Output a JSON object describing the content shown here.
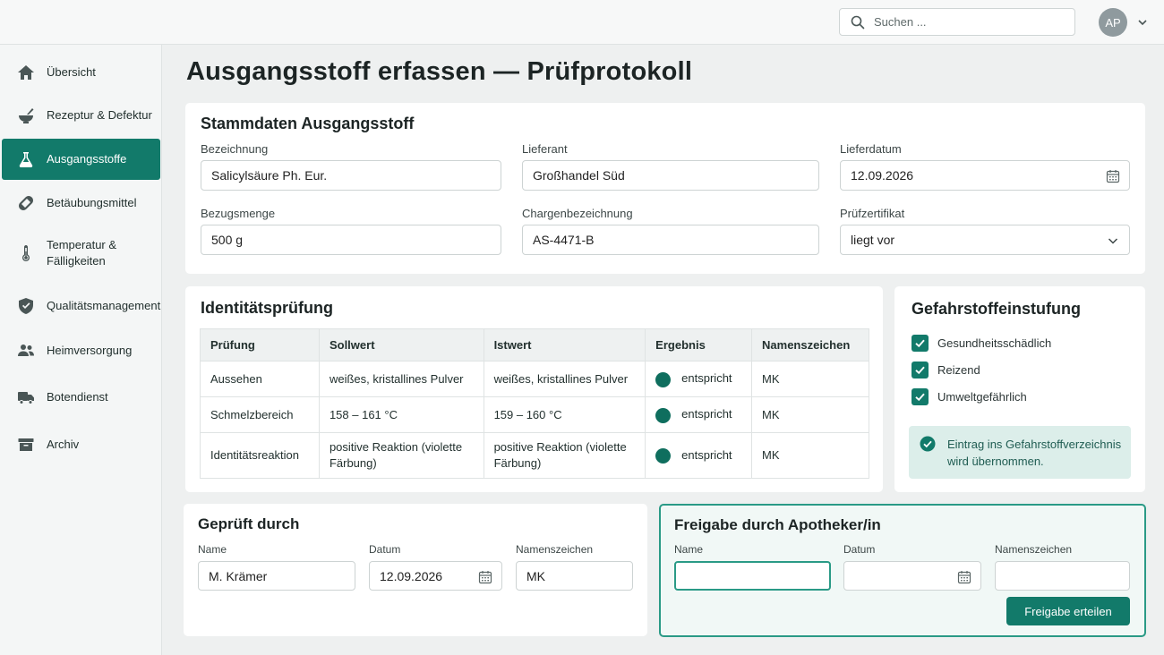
{
  "search": {
    "placeholder": "Suchen ..."
  },
  "user": {
    "initials": "AP"
  },
  "sidebar": {
    "items": [
      {
        "label": "Übersicht",
        "icon": "home-icon"
      },
      {
        "label": "Rezeptur & Defektur",
        "icon": "mortar-icon"
      },
      {
        "label": "Ausgangsstoffe",
        "icon": "flask-icon",
        "active": true
      },
      {
        "label": "Betäubungsmittel",
        "icon": "pill-icon"
      },
      {
        "label": "Temperatur & Fälligkeiten",
        "icon": "thermometer-icon"
      },
      {
        "label": "Qualitätsmanagement",
        "icon": "shield-check-icon"
      },
      {
        "label": "Heimversorgung",
        "icon": "people-icon"
      },
      {
        "label": "Botendienst",
        "icon": "truck-icon"
      },
      {
        "label": "Archiv",
        "icon": "archive-icon"
      }
    ]
  },
  "page": {
    "title": "Ausgangsstoff erfassen — Prüfprotokoll"
  },
  "stammdaten": {
    "title": "Stammdaten Ausgangsstoff",
    "bezeichnung": {
      "label": "Bezeichnung",
      "value": "Salicylsäure Ph. Eur."
    },
    "lieferant": {
      "label": "Lieferant",
      "value": "Großhandel Süd"
    },
    "lieferdatum": {
      "label": "Lieferdatum",
      "value": "12.09.2026"
    },
    "bezugsmenge": {
      "label": "Bezugsmenge",
      "value": "500 g"
    },
    "charge": {
      "label": "Chargenbezeichnung",
      "value": "AS-4471-B"
    },
    "zertifikat": {
      "label": "Prüfzertifikat",
      "value": "liegt vor"
    }
  },
  "identitaet": {
    "title": "Identitätsprüfung",
    "headers": [
      "Prüfung",
      "Sollwert",
      "Istwert",
      "Ergebnis",
      "Namenszeichen"
    ],
    "rows": [
      {
        "pruefung": "Aussehen",
        "soll": "weißes, kristallines Pulver",
        "ist": "weißes, kristallines Pulver",
        "ergebnis": "entspricht",
        "zeichen": "MK"
      },
      {
        "pruefung": "Schmelzbereich",
        "soll": "158 – 161 °C",
        "ist": "159 – 160 °C",
        "ergebnis": "entspricht",
        "zeichen": "MK"
      },
      {
        "pruefung": "Identitätsreaktion",
        "soll": "positive Reaktion (violette Färbung)",
        "ist": "positive Reaktion (violette Färbung)",
        "ergebnis": "entspricht",
        "zeichen": "MK"
      }
    ]
  },
  "gefahr": {
    "title": "Gefahrstoffeinstufung",
    "items": [
      "Gesundheitsschädlich",
      "Reizend",
      "Umweltgefährlich"
    ],
    "notice": "Eintrag ins Gefahrstoffverzeichnis wird übernommen."
  },
  "geprueft": {
    "title": "Geprüft durch",
    "name_label": "Name",
    "name": "M. Krämer",
    "datum_label": "Datum",
    "datum": "12.09.2026",
    "zeichen_label": "Namenszeichen",
    "zeichen": "MK"
  },
  "freigabe": {
    "title": "Freigabe durch Apotheker/in",
    "name_label": "Name",
    "name": "",
    "datum_label": "Datum",
    "datum": "",
    "zeichen_label": "Namenszeichen",
    "zeichen": "",
    "button": "Freigabe erteilen"
  },
  "colors": {
    "accent": "#127a6a",
    "result_dot": "#0f6e5e",
    "notice_bg": "#dceeea"
  }
}
